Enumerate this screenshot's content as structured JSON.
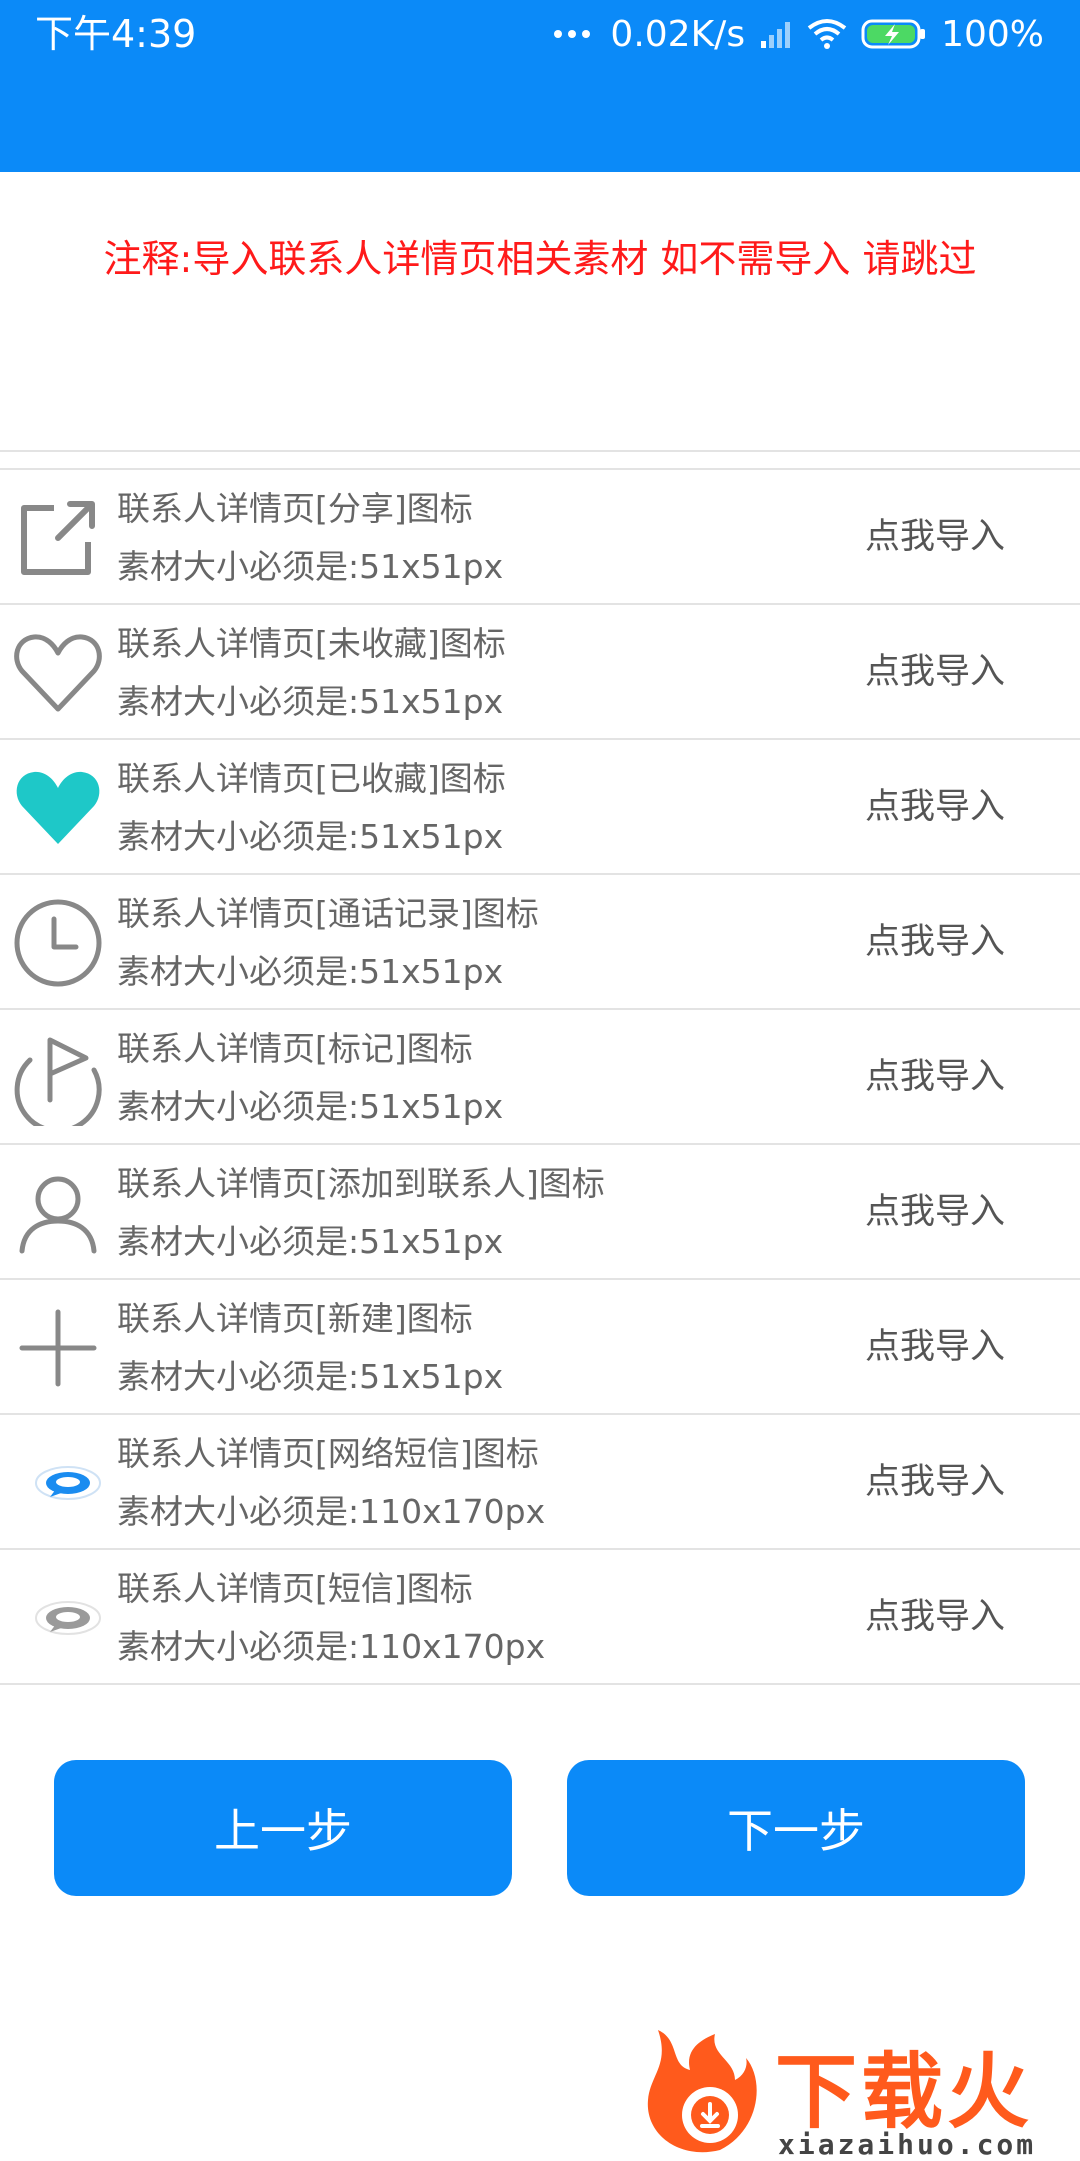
{
  "status_bar": {
    "time": "下午4:39",
    "network_speed": "0.02K/s",
    "battery": "100%"
  },
  "note": "注释:导入联系人详情页相关素材  如不需导入 请跳过",
  "items": [
    {
      "icon": "share-icon",
      "title": "联系人详情页[分享]图标",
      "size": "素材大小必须是:51x51px",
      "action": "点我导入"
    },
    {
      "icon": "heart-outline-icon",
      "title": "联系人详情页[未收藏]图标",
      "size": "素材大小必须是:51x51px",
      "action": "点我导入"
    },
    {
      "icon": "heart-filled-icon",
      "title": "联系人详情页[已收藏]图标",
      "size": "素材大小必须是:51x51px",
      "action": "点我导入"
    },
    {
      "icon": "clock-icon",
      "title": "联系人详情页[通话记录]图标",
      "size": "素材大小必须是:51x51px",
      "action": "点我导入"
    },
    {
      "icon": "flag-icon",
      "title": "联系人详情页[标记]图标",
      "size": "素材大小必须是:51x51px",
      "action": "点我导入"
    },
    {
      "icon": "person-icon",
      "title": "联系人详情页[添加到联系人]图标",
      "size": "素材大小必须是:51x51px",
      "action": "点我导入"
    },
    {
      "icon": "plus-icon",
      "title": "联系人详情页[新建]图标",
      "size": "素材大小必须是:51x51px",
      "action": "点我导入"
    },
    {
      "icon": "chat-bubble-blue-icon",
      "title": "联系人详情页[网络短信]图标",
      "size": "素材大小必须是:110x170px",
      "action": "点我导入"
    },
    {
      "icon": "chat-bubble-gray-icon",
      "title": "联系人详情页[短信]图标",
      "size": "素材大小必须是:110x170px",
      "action": "点我导入"
    }
  ],
  "buttons": {
    "prev": "上一步",
    "next": "下一步"
  },
  "watermark": {
    "brand": "下载火",
    "url": "xiazaihuo.com"
  },
  "colors": {
    "primary": "#0b8af8",
    "note_red": "#ff1a1a",
    "favorite_teal": "#1ec8c8",
    "icon_gray": "#888888"
  }
}
